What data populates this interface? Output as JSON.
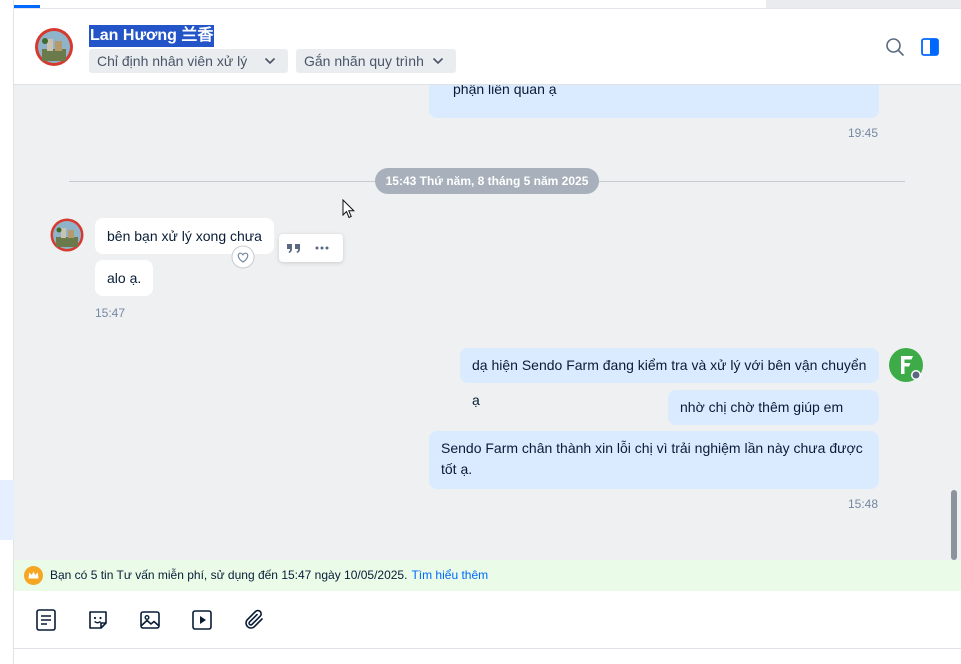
{
  "header": {
    "contact_name": "Lan Hương 兰香",
    "assign_dropdown": "Chỉ định nhân viên xử lý",
    "label_dropdown": "Gắn nhãn quy trình"
  },
  "messages": {
    "prev_out_line2": "phận liên quan ạ",
    "prev_time": "19:45",
    "date_separator": "15:43 Thứ năm, 8 tháng 5 năm 2025",
    "in_1": "bên bạn xử lý xong chưa",
    "in_2": "alo ạ.",
    "in_time": "15:47",
    "out_1": "dạ hiện Sendo Farm đang kiểm tra và xử lý với bên vận chuyển ạ",
    "out_2": "nhờ chị chờ thêm giúp em nhé",
    "out_3": "Sendo Farm chân thành xin lỗi chị vì trải nghiệm lần này chưa được tốt ạ.",
    "out_time": "15:48"
  },
  "promo": {
    "text": "Bạn có 5 tin Tư vấn miễn phí, sử dụng đến 15:47 ngày 10/05/2025.",
    "link": "Tìm hiểu thêm"
  },
  "colors": {
    "accent": "#0068ff",
    "out_bubble": "#dbebff",
    "in_bubble": "#ffffff",
    "chat_bg": "#eef0f1",
    "promo_bg": "#eafbe7",
    "brand_green": "#3dab48"
  }
}
